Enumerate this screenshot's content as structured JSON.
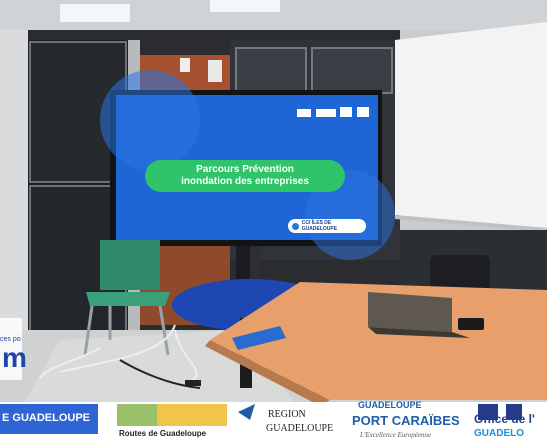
{
  "slide": {
    "title_line1": "Parcours Prévention",
    "title_line2": "inondation des entreprises",
    "footer_logo": "CCI ÎLES DE GUADELOUPE"
  },
  "partners": {
    "cci_banner": "E GUADELOUPE",
    "cci_fragment": "ces po",
    "cci_letters": "m",
    "routes": "Routes de Guadeloupe",
    "region_line1": "REGION",
    "region_line2": "GUADELOUPE",
    "port_line1": "GUADELOUPE",
    "port_line2": "PORT CARAÏBES",
    "port_tagline": "L'Excellence Européenne",
    "office_line1": "Office de l'",
    "office_line2": "GUADELO"
  },
  "colors": {
    "screen": "#1e66d6",
    "button_green": "#2fc46a",
    "table": "#e7a06b",
    "chair": "#2f8a6b"
  }
}
